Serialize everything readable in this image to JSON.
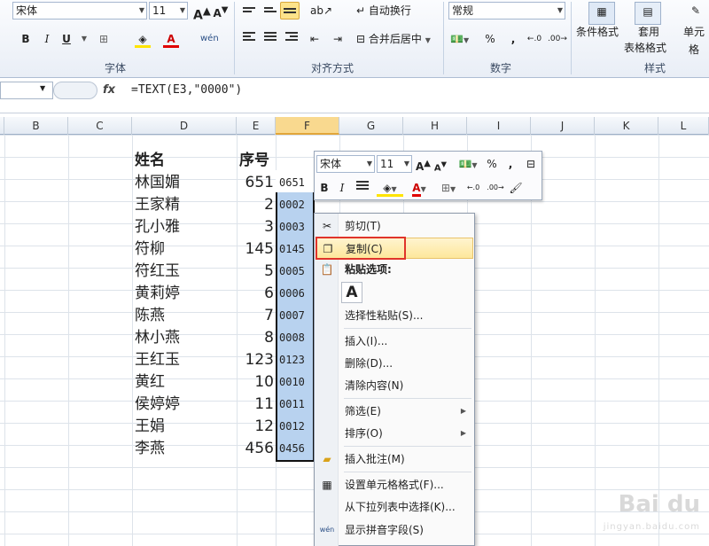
{
  "ribbon": {
    "font_name": "宋体",
    "font_size": "11",
    "grow_font": "A",
    "shrink_font": "A",
    "bold": "B",
    "italic": "I",
    "underline": "U",
    "phonetic": "wén",
    "wrap_text": "自动换行",
    "merge_center": "合并后居中",
    "number_format": "常规",
    "percent": "%",
    "comma": ",",
    "conditional_format": "条件格式",
    "table_format_1": "套用",
    "table_format_2": "表格格式",
    "cell_styles": "单元格",
    "group_font": "字体",
    "group_align": "对齐方式",
    "group_number": "数字",
    "group_styles": "样式"
  },
  "formula_bar": {
    "fx": "fx",
    "formula": "=TEXT(E3,\"0000\")"
  },
  "columns": [
    "B",
    "C",
    "D",
    "E",
    "F",
    "G",
    "H",
    "I",
    "J",
    "K",
    "L"
  ],
  "sheet": {
    "header_name": "姓名",
    "header_seq": "序号",
    "rows": [
      {
        "name": "林国媚",
        "seq": "651",
        "text": "0651"
      },
      {
        "name": "王家精",
        "seq": "2",
        "text": "0002"
      },
      {
        "name": "孔小雅",
        "seq": "3",
        "text": "0003"
      },
      {
        "name": "符柳",
        "seq": "145",
        "text": "0145"
      },
      {
        "name": "符红玉",
        "seq": "5",
        "text": "0005"
      },
      {
        "name": "黄莉婷",
        "seq": "6",
        "text": "0006"
      },
      {
        "name": "陈燕",
        "seq": "7",
        "text": "0007"
      },
      {
        "name": "林小燕",
        "seq": "8",
        "text": "0008"
      },
      {
        "name": "王红玉",
        "seq": "123",
        "text": "0123"
      },
      {
        "name": "黄红",
        "seq": "10",
        "text": "0010"
      },
      {
        "name": "侯婷婷",
        "seq": "11",
        "text": "0011"
      },
      {
        "name": "王娟",
        "seq": "12",
        "text": "0012"
      },
      {
        "name": "李燕",
        "seq": "456",
        "text": "0456"
      }
    ]
  },
  "mini_toolbar": {
    "font_name": "宋体",
    "font_size": "11",
    "bold": "B",
    "italic": "I",
    "percent": "%",
    "comma": ","
  },
  "context_menu": {
    "cut": "剪切(T)",
    "copy": "复制(C)",
    "paste_options": "粘贴选项:",
    "paste_a": "A",
    "paste_special": "选择性粘贴(S)...",
    "insert": "插入(I)...",
    "delete": "删除(D)...",
    "clear": "清除内容(N)",
    "filter": "筛选(E)",
    "sort": "排序(O)",
    "insert_comment": "插入批注(M)",
    "format_cells": "设置单元格格式(F)...",
    "pick_list": "从下拉列表中选择(K)...",
    "phonetic": "显示拼音字段(S)"
  },
  "watermark": {
    "brand": "Bai du",
    "site": "jingyan.baidu.com"
  },
  "colors": {
    "selection": "#b8d2ef",
    "highlight_border": "#e0342a",
    "menu_hover": "#fde79b"
  }
}
